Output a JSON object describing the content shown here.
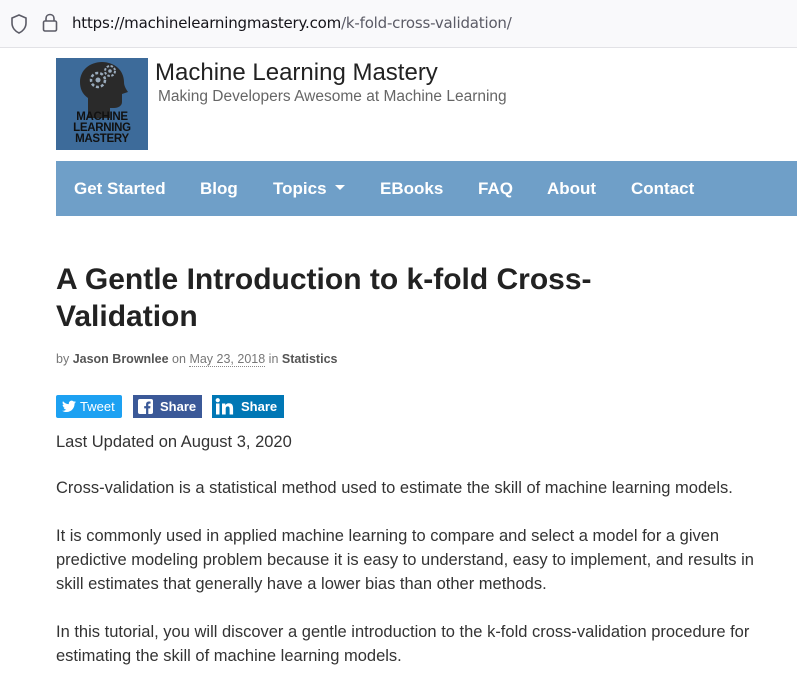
{
  "browser": {
    "url_domain": "https://machinelearningmastery.com",
    "url_path": "/k-fold-cross-validation/"
  },
  "site": {
    "logo_text": [
      "MACHINE",
      "LEARNING",
      "MASTERY"
    ],
    "title": "Machine Learning Mastery",
    "tagline": "Making Developers Awesome at Machine Learning"
  },
  "nav": {
    "items": [
      "Get Started",
      "Blog",
      "Topics",
      "EBooks",
      "FAQ",
      "About",
      "Contact"
    ]
  },
  "article": {
    "title": "A Gentle Introduction to k-fold Cross-Validation",
    "meta": {
      "by": "by",
      "author": "Jason Brownlee",
      "on": "on",
      "date": "May 23, 2018",
      "in": "in",
      "category": "Statistics"
    },
    "share": {
      "tweet": "Tweet",
      "facebook": "Share",
      "linkedin": "Share"
    },
    "last_updated": "Last Updated on August 3, 2020",
    "paragraphs": [
      "Cross-validation is a statistical method used to estimate the skill of machine learning models.",
      "It is commonly used in applied machine learning to compare and select a model for a given predictive modeling problem because it is easy to understand, easy to implement, and results in skill estimates that generally have a lower bias than other methods.",
      "In this tutorial, you will discover a gentle introduction to the k-fold cross-validation procedure for estimating the skill of machine learning models."
    ]
  },
  "colors": {
    "nav_bg": "#6f9fc8",
    "logo_bg": "#3d6b9a",
    "twitter": "#1da1f2",
    "facebook": "#3b5998",
    "linkedin": "#0077b5"
  }
}
